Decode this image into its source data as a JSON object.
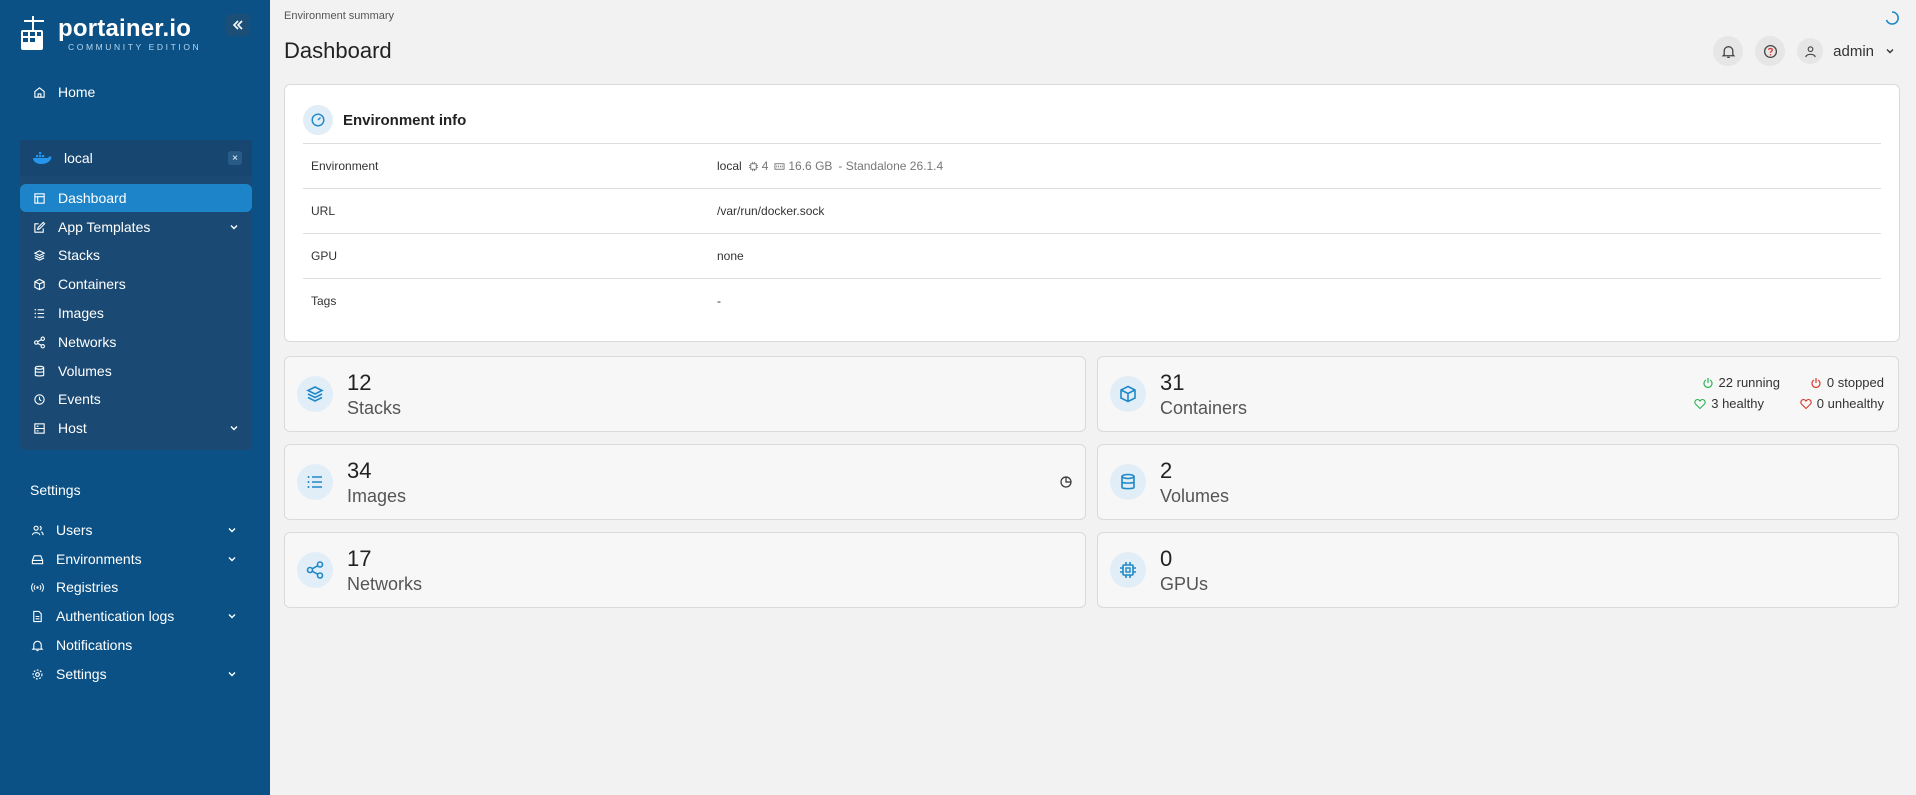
{
  "app": {
    "logo_main": "portainer.io",
    "logo_sub": "COMMUNITY EDITION"
  },
  "sidebar": {
    "home": "Home",
    "environment": {
      "name": "local",
      "close": "×"
    },
    "env_items": [
      {
        "label": "Dashboard",
        "icon": "dashboard-icon",
        "active": true
      },
      {
        "label": "App Templates",
        "icon": "edit-icon",
        "expandable": true
      },
      {
        "label": "Stacks",
        "icon": "layers-icon"
      },
      {
        "label": "Containers",
        "icon": "box-icon"
      },
      {
        "label": "Images",
        "icon": "list-icon"
      },
      {
        "label": "Networks",
        "icon": "share-icon"
      },
      {
        "label": "Volumes",
        "icon": "database-icon"
      },
      {
        "label": "Events",
        "icon": "clock-icon"
      },
      {
        "label": "Host",
        "icon": "server-icon",
        "expandable": true
      }
    ],
    "settings_title": "Settings",
    "settings_items": [
      {
        "label": "Users",
        "icon": "users-icon",
        "expandable": true
      },
      {
        "label": "Environments",
        "icon": "hdd-icon",
        "expandable": true
      },
      {
        "label": "Registries",
        "icon": "radio-icon"
      },
      {
        "label": "Authentication logs",
        "icon": "file-icon",
        "expandable": true
      },
      {
        "label": "Notifications",
        "icon": "bell-icon"
      },
      {
        "label": "Settings",
        "icon": "gear-icon",
        "expandable": true
      }
    ]
  },
  "header": {
    "breadcrumb": "Environment summary",
    "title": "Dashboard",
    "user": "admin"
  },
  "env_info": {
    "title": "Environment info",
    "rows": [
      {
        "label": "Environment",
        "value": "local",
        "cpu": "4",
        "memory": "16.6 GB",
        "extra": "- Standalone 26.1.4"
      },
      {
        "label": "URL",
        "value": "/var/run/docker.sock"
      },
      {
        "label": "GPU",
        "value": "none"
      },
      {
        "label": "Tags",
        "value": "-"
      }
    ]
  },
  "stats": {
    "stacks": {
      "count": "12",
      "label": "Stacks"
    },
    "containers": {
      "count": "31",
      "label": "Containers",
      "running": "22 running",
      "stopped": "0 stopped",
      "healthy": "3 healthy",
      "unhealthy": "0 unhealthy"
    },
    "images": {
      "count": "34",
      "label": "Images"
    },
    "volumes": {
      "count": "2",
      "label": "Volumes"
    },
    "networks": {
      "count": "17",
      "label": "Networks"
    },
    "gpus": {
      "count": "0",
      "label": "GPUs"
    }
  },
  "colors": {
    "sidebar": "#0b5185",
    "active": "#1d84c9",
    "accent": "#1f88c6",
    "green": "#2fb457",
    "red": "#d73a2e"
  }
}
